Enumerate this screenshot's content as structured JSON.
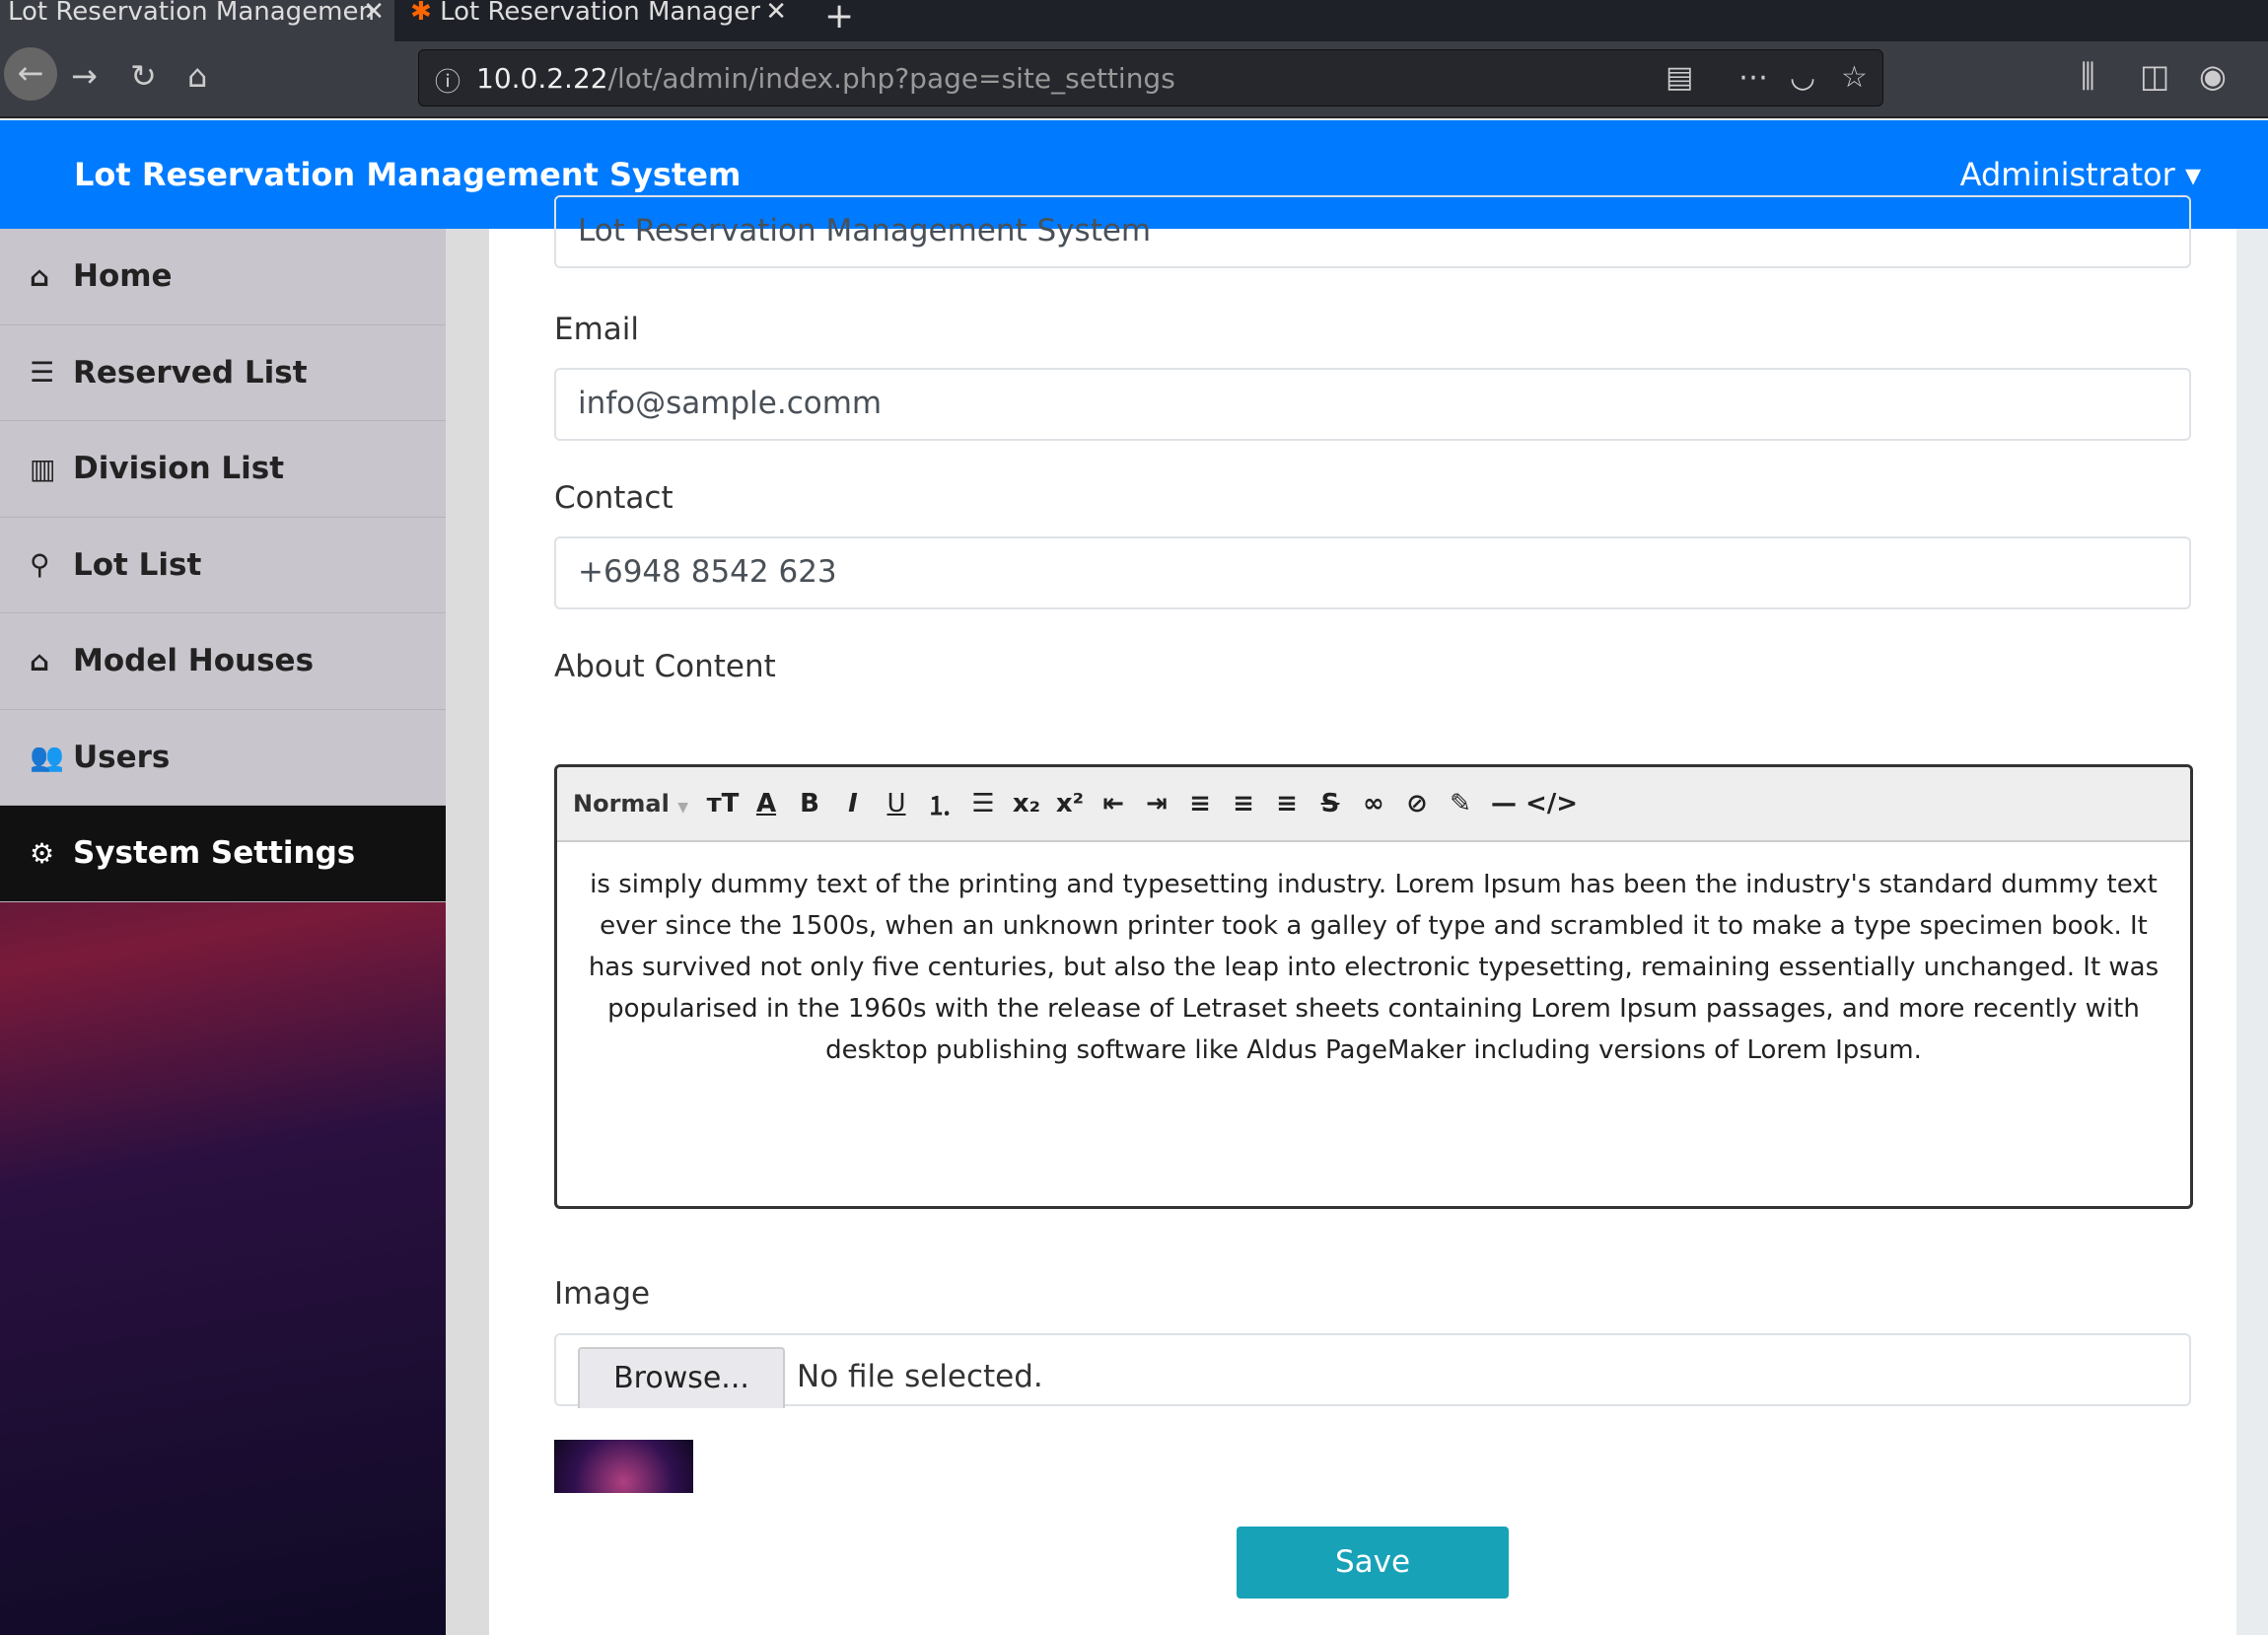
{
  "browser": {
    "tabs": [
      {
        "title": "Lot Reservation Managemen"
      },
      {
        "title": "Lot Reservation Manager"
      }
    ],
    "url_host": "10.0.2.22",
    "url_path": "/lot/admin/index.php?page=site_settings"
  },
  "header": {
    "brand": "Lot Reservation Management System",
    "user_menu": "Administrator ▾"
  },
  "sidebar": {
    "items": [
      {
        "label": "Home",
        "icon": "home-icon",
        "glyph": "⌂"
      },
      {
        "label": "Reserved List",
        "icon": "list-icon",
        "glyph": "☰"
      },
      {
        "label": "Division List",
        "icon": "map-icon",
        "glyph": "▥"
      },
      {
        "label": "Lot List",
        "icon": "map-marker-icon",
        "glyph": "⚲"
      },
      {
        "label": "Model Houses",
        "icon": "home-icon",
        "glyph": "⌂"
      },
      {
        "label": "Users",
        "icon": "users-icon",
        "glyph": "👥"
      },
      {
        "label": "System Settings",
        "icon": "cogs-icon",
        "glyph": "⚙"
      }
    ]
  },
  "form": {
    "system_name_value": "Lot Reservation Management System",
    "email_label": "Email",
    "email_value": "info@sample.comm",
    "contact_label": "Contact",
    "contact_value": "+6948 8542 623",
    "about_label": "About Content",
    "editor_style": "Normal",
    "about_text": "is simply dummy text of the printing and typesetting industry. Lorem Ipsum has been the industry's standard dummy text ever since the 1500s, when an unknown printer took a galley of type and scrambled it to make a type specimen book. It has survived not only five centuries, but also the leap into electronic typesetting, remaining essentially unchanged. It was popularised in the 1960s with the release of Letraset sheets containing Lorem Ipsum passages, and more recently with desktop publishing software like Aldus PageMaker including versions of Lorem Ipsum.",
    "image_label": "Image",
    "browse_label": "Browse...",
    "file_status": "No file selected.",
    "save_label": "Save"
  }
}
